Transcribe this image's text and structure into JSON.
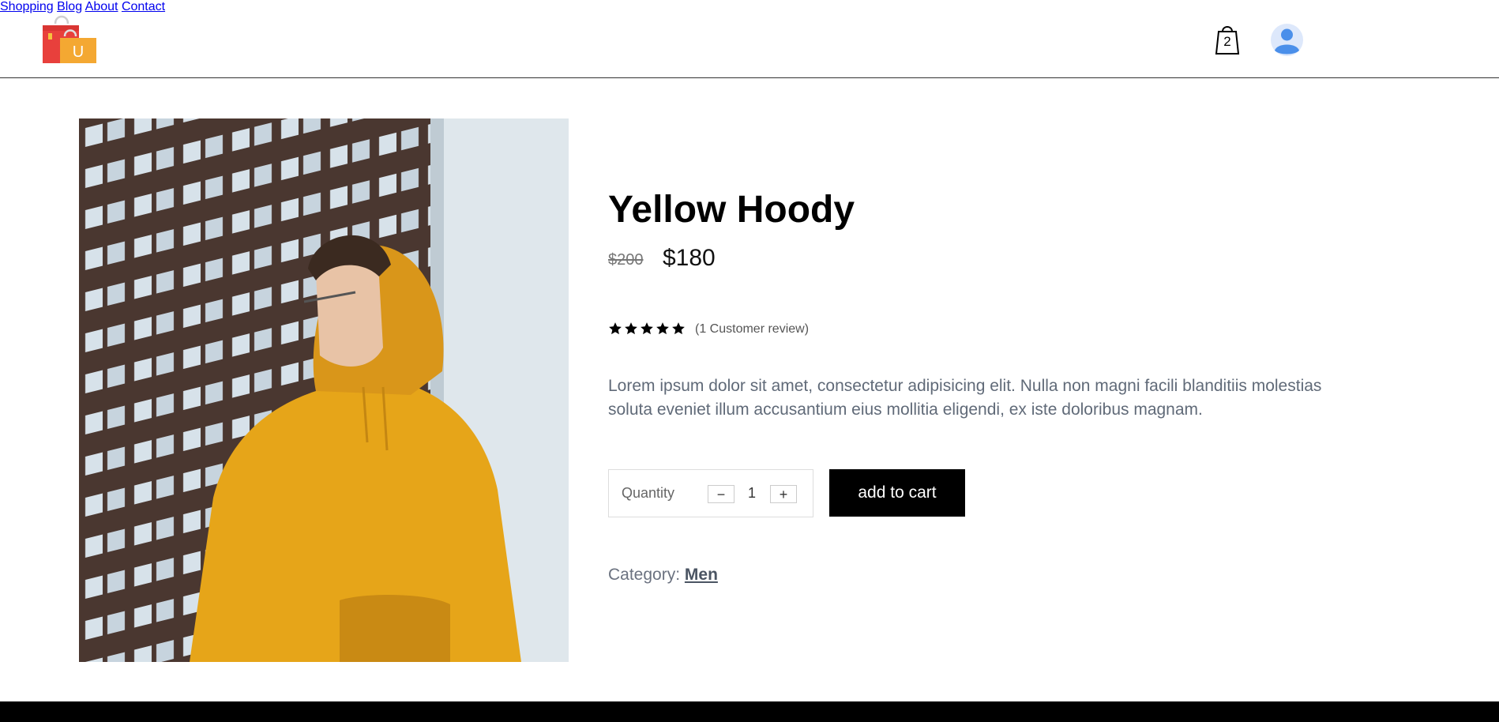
{
  "header": {
    "logo_letter": "U",
    "nav": [
      {
        "label": "Shopping"
      },
      {
        "label": "Blog"
      },
      {
        "label": "About"
      },
      {
        "label": "Contact"
      }
    ],
    "cart_count": "2"
  },
  "product": {
    "title": "Yellow Hoody",
    "old_price": "$200",
    "new_price": "$180",
    "rating": 5,
    "review_text": "(1 Customer review)",
    "description": "Lorem ipsum dolor sit amet, consectetur adipisicing elit. Nulla non magni facili blanditiis molestias soluta eveniet illum accusantium eius mollitia eligendi, ex iste doloribus magnam.",
    "quantity_label": "Quantity",
    "quantity_value": "1",
    "minus_label": "−",
    "plus_label": "+",
    "add_to_cart_label": "add to cart",
    "category_label": "Category: ",
    "category_value": "Men"
  },
  "colors": {
    "bag_red": "#e8403c",
    "bag_orange": "#f4a832",
    "hoodie": "#e6a519",
    "building": "#4a3730",
    "avatar_blue": "#4a8fea"
  }
}
